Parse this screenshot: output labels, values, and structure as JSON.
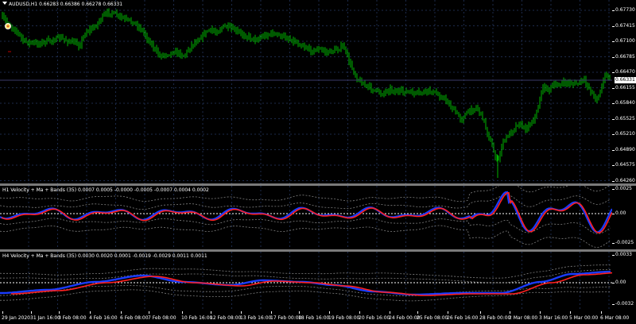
{
  "colors": {
    "background": "#000000",
    "grid": "#1c2a4a",
    "bull_candle": "#00b300",
    "price_line": "#ffffff",
    "velocity_blue": "#1a3cff",
    "velocity_red": "#ff2020",
    "bands": "#808080"
  },
  "main_chart": {
    "title": "AUDUSD,H1  0.66283 0.66386 0.66278 0.66331",
    "price_labels": [
      "0.67730",
      "0.67415",
      "0.67100",
      "0.66785",
      "0.66470",
      "0.66155",
      "0.65840",
      "0.65525",
      "0.65210",
      "0.64890",
      "0.64575",
      "0.64260"
    ],
    "current_price": "0.66331"
  },
  "indicator1": {
    "title": "H1 Velocity + Ma + Bands (35) 0.0007 0.0005 -0.0000 -0.0005 -0.0007 0.0004 0.0002",
    "scale_labels": [
      "0.0025",
      "0.00",
      "-0.0025"
    ]
  },
  "indicator2": {
    "title": "H4 Velocity + Ma + Bands (35) 0.0030 0.0020 0.0001 -0.0019 -0.0029 0.0011 0.0011",
    "scale_labels": [
      "0.0033",
      "0.00",
      "-0.0032"
    ]
  },
  "time_axis": [
    "29 Jan 2020",
    "31 Jan 16:00",
    "3 Feb 08:00",
    "4 Feb 16:00",
    "6 Feb 08:00",
    "7 Feb 08:00",
    "10 Feb 16:00",
    "12 Feb 08:00",
    "13 Feb 16:00",
    "17 Feb 00:00",
    "18 Feb 16:00",
    "19 Feb 08:00",
    "20 Feb 16:00",
    "24 Feb 00:00",
    "25 Feb 08:00",
    "26 Feb 16:00",
    "28 Feb 00:00",
    "2 Mar 08:00",
    "3 Mar 16:00",
    "5 Mar 00:00",
    "6 Mar 08:00"
  ]
}
